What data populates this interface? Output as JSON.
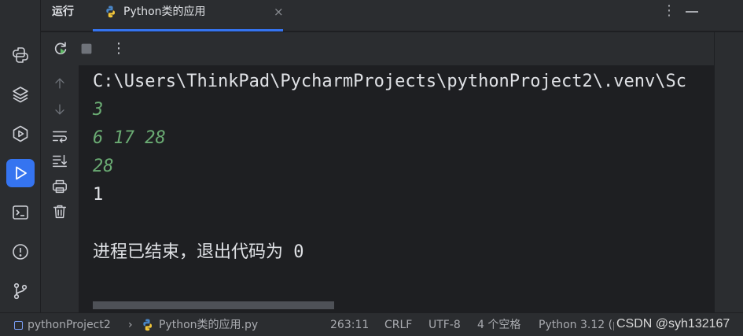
{
  "header": {
    "run_title": "运行",
    "tab_label": "Python类的应用",
    "tab_close": "×",
    "more": "⋮"
  },
  "toolbar": {
    "more": "⋮"
  },
  "console": {
    "lines": [
      "C:\\Users\\ThinkPad\\PycharmProjects\\pythonProject2\\.venv\\Sc",
      "3",
      "6 17 28",
      "28",
      "1",
      "进程已结束，退出代码为 0"
    ]
  },
  "statusbar": {
    "project": "pythonProject2",
    "sep": "›",
    "file": "Python类的应用.py",
    "position": "263:11",
    "line_ending": "CRLF",
    "encoding": "UTF-8",
    "indent": "4 个空格",
    "interpreter": "Python 3.12 (pythonProject2)"
  },
  "watermark": "CSDN @syh132167",
  "colors": {
    "accent": "#3574f0",
    "output_green": "#6aab73",
    "background": "#1e1f22",
    "panel": "#2b2d30"
  },
  "icons": {
    "left_strip": [
      "python-packages-icon",
      "layers-icon",
      "services-icon",
      "run-icon",
      "terminal-icon",
      "problems-icon",
      "git-icon"
    ],
    "toolbar": [
      "rerun-icon",
      "stop-icon",
      "more-icon"
    ],
    "gutter": [
      "scroll-up-icon",
      "scroll-down-icon",
      "soft-wrap-icon",
      "scroll-to-end-icon",
      "print-icon",
      "trash-icon"
    ]
  }
}
